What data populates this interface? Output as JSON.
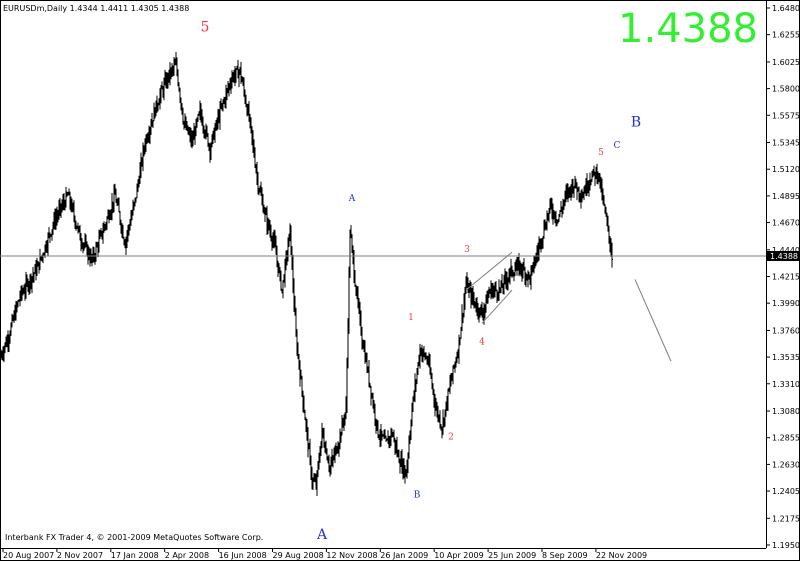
{
  "header": {
    "symbol_line": "EURUSDm,Daily  1.4344 1.4411 1.4305 1.4388"
  },
  "big_price": "1.4388",
  "copyright": "Interbank FX Trader 4, © 2001-2009 MetaQuotes Software Corp.",
  "colors": {
    "bars": "#000000",
    "wave_red": "#ff3333",
    "wave_blue": "#2233cc",
    "big_price": "#33ee33",
    "grid": "#000000"
  },
  "chart_data": {
    "type": "ohlc",
    "title": "",
    "xlabel": "",
    "ylabel": "",
    "ylim": [
      1.195,
      1.648
    ],
    "y_ticks": [
      "1.6480",
      "1.6255",
      "1.6025",
      "1.5800",
      "1.5575",
      "1.5345",
      "1.5120",
      "1.4895",
      "1.4670",
      "1.4440",
      "1.4215",
      "1.3990",
      "1.3760",
      "1.3535",
      "1.3310",
      "1.3080",
      "1.2855",
      "1.2630",
      "1.2405",
      "1.2175",
      "1.1950"
    ],
    "x_ticks": [
      "20 Aug 2007",
      "2 Nov 2007",
      "17 Jan 2008",
      "2 Apr 2008",
      "16 Jun 2008",
      "29 Aug 2008",
      "12 Nov 2008",
      "26 Jan 2009",
      "10 Apr 2009",
      "25 Jun 2009",
      "8 Sep 2009",
      "22 Nov 2009"
    ],
    "current_price": {
      "label": "1.4388",
      "value": 1.4388
    },
    "anchors": [
      [
        0,
        1.3535
      ],
      [
        8,
        1.37
      ],
      [
        20,
        1.405
      ],
      [
        38,
        1.43
      ],
      [
        55,
        1.47
      ],
      [
        68,
        1.49
      ],
      [
        80,
        1.455
      ],
      [
        92,
        1.435
      ],
      [
        105,
        1.465
      ],
      [
        115,
        1.49
      ],
      [
        125,
        1.45
      ],
      [
        135,
        1.485
      ],
      [
        145,
        1.535
      ],
      [
        158,
        1.57
      ],
      [
        168,
        1.59
      ],
      [
        176,
        1.6
      ],
      [
        184,
        1.55
      ],
      [
        192,
        1.535
      ],
      [
        200,
        1.56
      ],
      [
        210,
        1.53
      ],
      [
        220,
        1.56
      ],
      [
        232,
        1.59
      ],
      [
        240,
        1.595
      ],
      [
        250,
        1.55
      ],
      [
        258,
        1.5
      ],
      [
        266,
        1.47
      ],
      [
        274,
        1.45
      ],
      [
        282,
        1.41
      ],
      [
        290,
        1.46
      ],
      [
        296,
        1.37
      ],
      [
        304,
        1.31
      ],
      [
        312,
        1.25
      ],
      [
        316,
        1.245
      ],
      [
        322,
        1.29
      ],
      [
        330,
        1.26
      ],
      [
        338,
        1.28
      ],
      [
        346,
        1.31
      ],
      [
        350,
        1.46
      ],
      [
        356,
        1.41
      ],
      [
        362,
        1.37
      ],
      [
        370,
        1.33
      ],
      [
        378,
        1.29
      ],
      [
        386,
        1.28
      ],
      [
        392,
        1.29
      ],
      [
        398,
        1.27
      ],
      [
        406,
        1.255
      ],
      [
        412,
        1.31
      ],
      [
        420,
        1.36
      ],
      [
        428,
        1.35
      ],
      [
        436,
        1.31
      ],
      [
        442,
        1.295
      ],
      [
        450,
        1.33
      ],
      [
        458,
        1.36
      ],
      [
        466,
        1.415
      ],
      [
        474,
        1.4
      ],
      [
        482,
        1.39
      ],
      [
        490,
        1.41
      ],
      [
        500,
        1.41
      ],
      [
        510,
        1.425
      ],
      [
        520,
        1.43
      ],
      [
        530,
        1.42
      ],
      [
        540,
        1.45
      ],
      [
        550,
        1.48
      ],
      [
        558,
        1.47
      ],
      [
        566,
        1.49
      ],
      [
        574,
        1.5
      ],
      [
        582,
        1.49
      ],
      [
        590,
        1.505
      ],
      [
        598,
        1.51
      ],
      [
        604,
        1.48
      ],
      [
        610,
        1.45
      ],
      [
        612,
        1.4388
      ]
    ],
    "annotations": [
      {
        "text": "5",
        "pos": [
          205,
          1.628
        ],
        "color": "red",
        "size": "big"
      },
      {
        "text": "A",
        "pos": [
          352,
          1.485
        ],
        "color": "blue",
        "size": "small"
      },
      {
        "text": "B",
        "pos": [
          417,
          1.235
        ],
        "color": "blue",
        "size": "small"
      },
      {
        "text": "A",
        "pos": [
          322,
          1.2
        ],
        "color": "blue",
        "size": "big"
      },
      {
        "text": "1",
        "pos": [
          411,
          1.385
        ],
        "color": "red",
        "size": "small"
      },
      {
        "text": "2",
        "pos": [
          451,
          1.284
        ],
        "color": "red",
        "size": "small"
      },
      {
        "text": "3",
        "pos": [
          467,
          1.442
        ],
        "color": "red",
        "size": "small"
      },
      {
        "text": "4",
        "pos": [
          482,
          1.364
        ],
        "color": "red",
        "size": "small"
      },
      {
        "text": "5",
        "pos": [
          601,
          1.524
        ],
        "color": "red",
        "size": "small"
      },
      {
        "text": "C",
        "pos": [
          617,
          1.53
        ],
        "color": "blue",
        "size": "small"
      },
      {
        "text": "B",
        "pos": [
          636,
          1.548
        ],
        "color": "blue",
        "size": "big"
      }
    ],
    "lines": [
      {
        "from": [
          466,
          1.41
        ],
        "to": [
          512,
          1.442
        ]
      },
      {
        "from": [
          482,
          1.382
        ],
        "to": [
          512,
          1.41
        ]
      },
      {
        "from": [
          635,
          1.419
        ],
        "to": [
          671,
          1.35
        ]
      }
    ]
  }
}
